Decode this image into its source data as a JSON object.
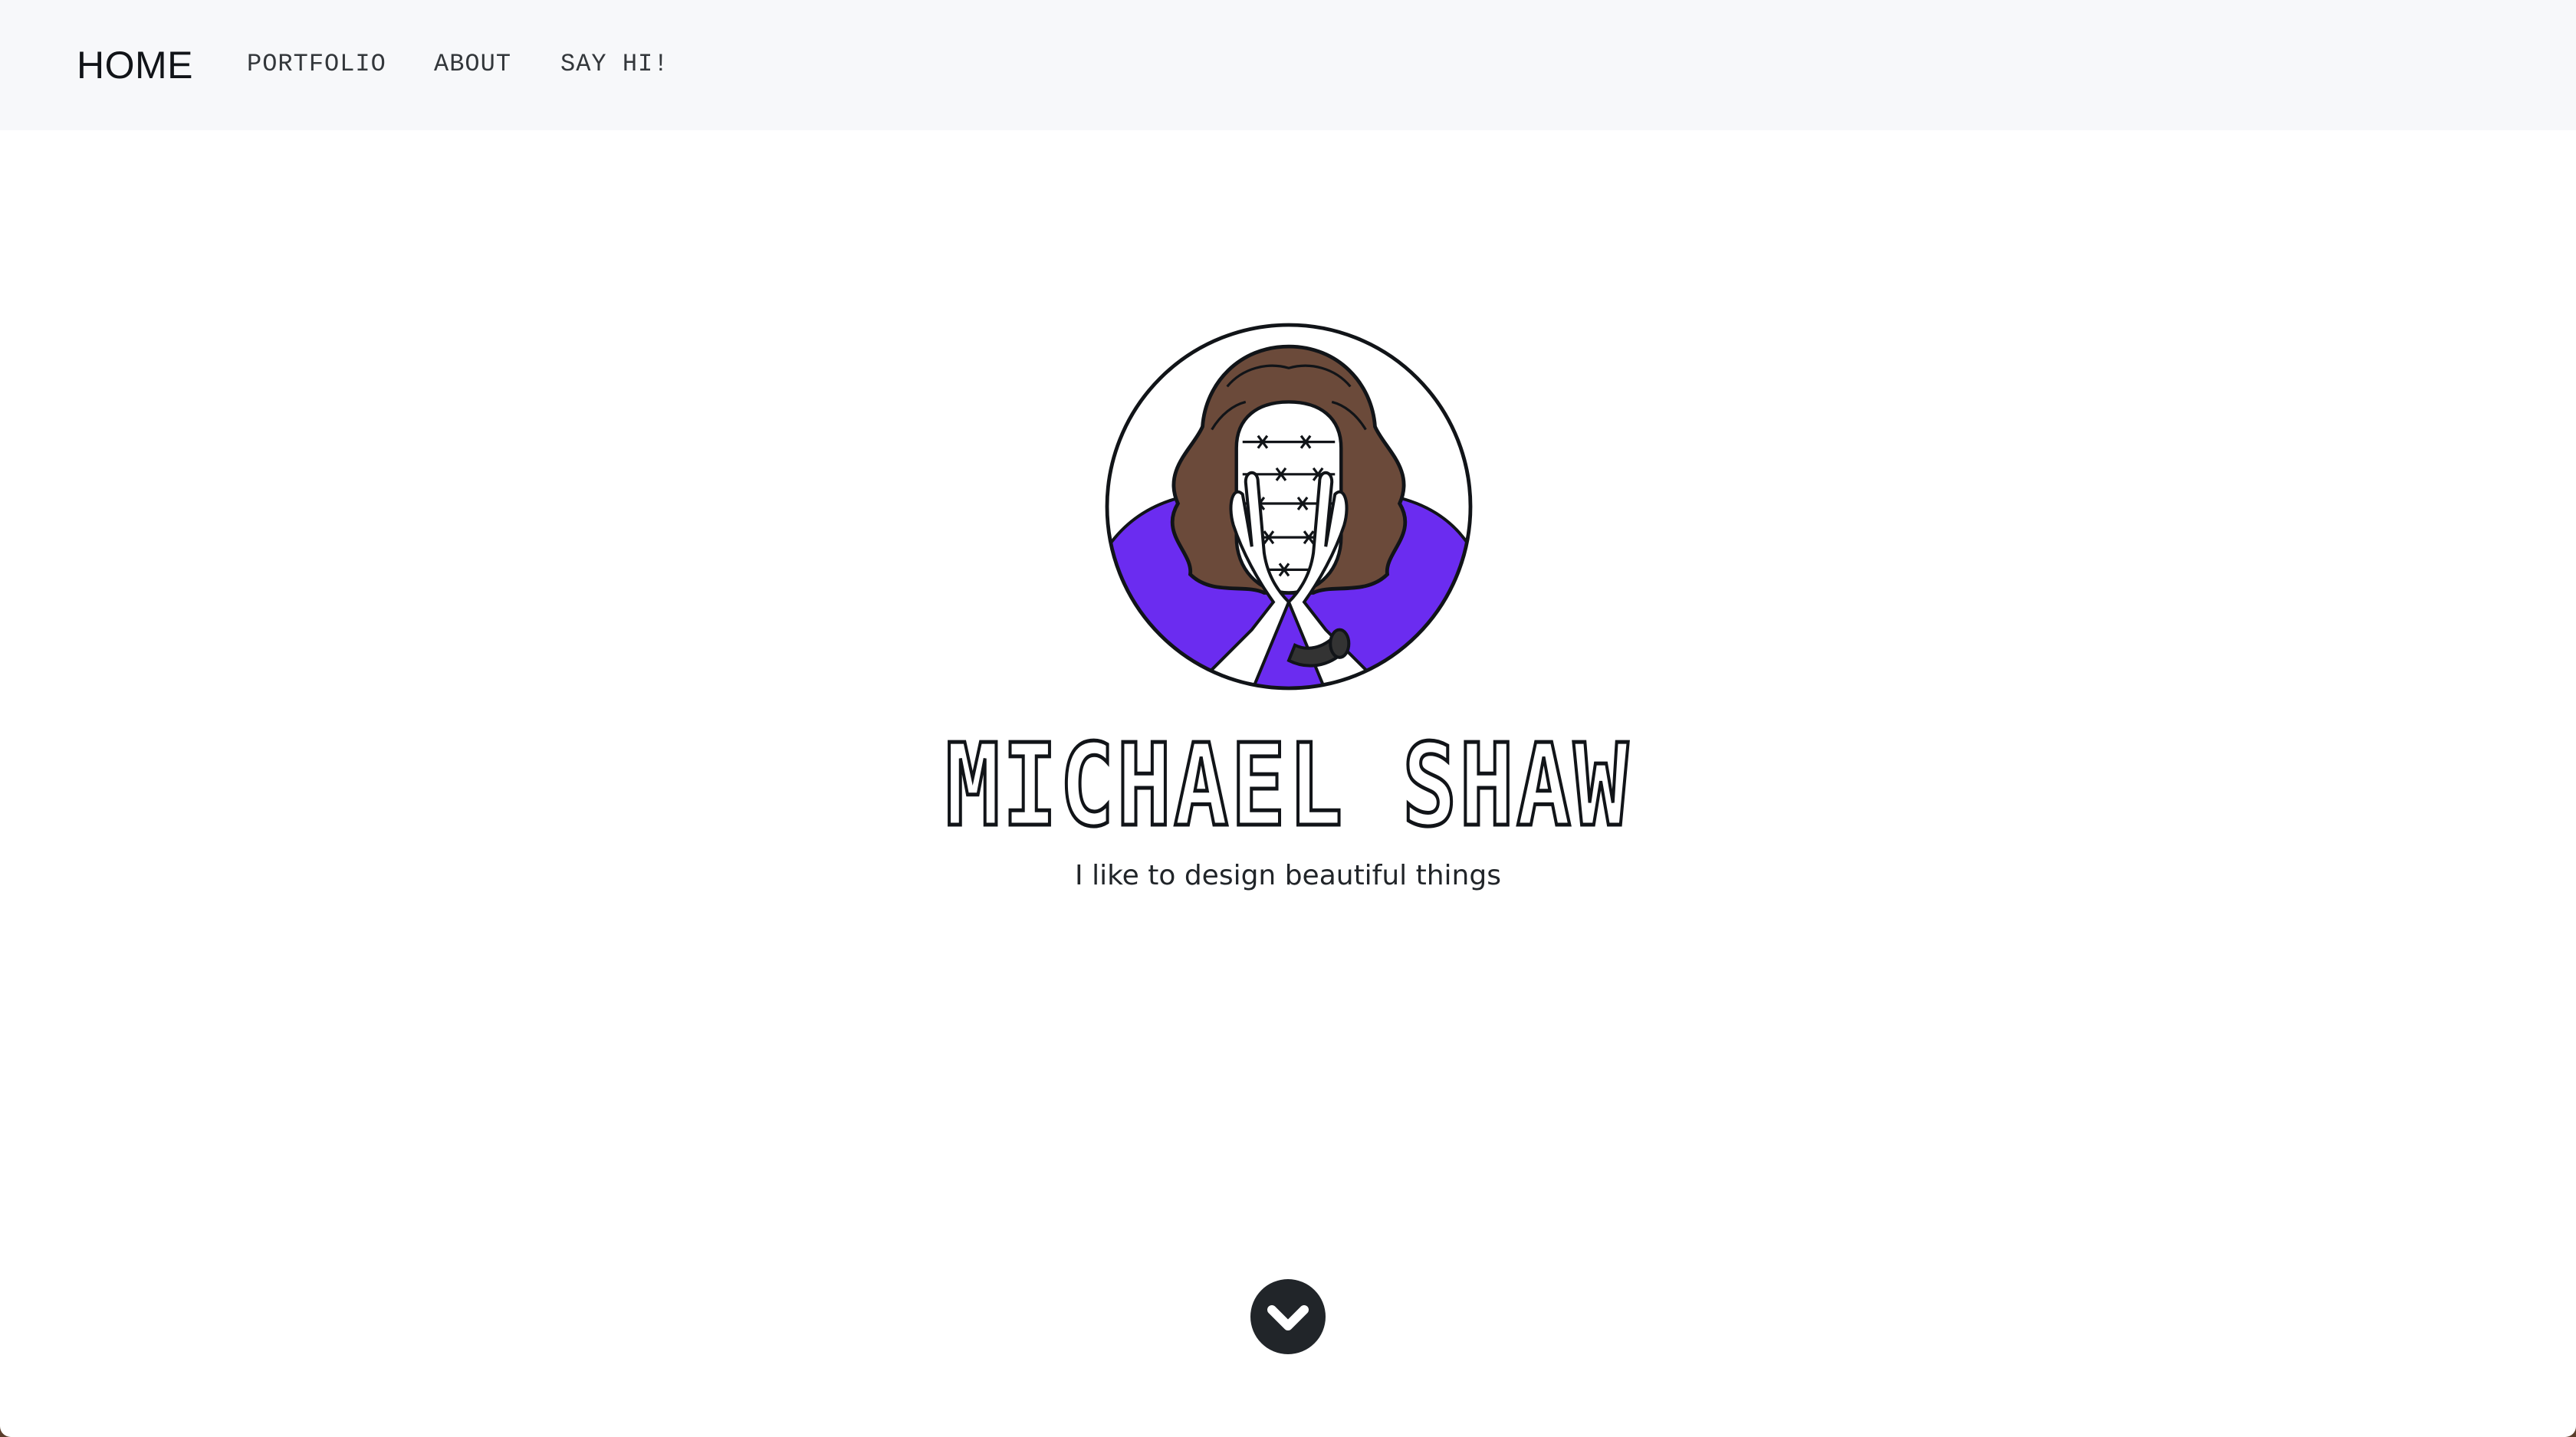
{
  "nav": {
    "brand": "HOME",
    "links": [
      {
        "label": "PORTFOLIO"
      },
      {
        "label": "ABOUT"
      },
      {
        "label": "SAY HI!"
      }
    ]
  },
  "hero": {
    "name": "MICHAEL SHAW",
    "tagline": "I like to design beautiful things",
    "avatar_icon": "portrait-illustration",
    "scroll_icon": "chevron-down-icon"
  },
  "colors": {
    "navbar_bg": "#f7f8fa",
    "text": "#212529",
    "accent_purple": "#6b2cf0",
    "hair_brown": "#6b4a3a",
    "scroll_button": "#212529"
  }
}
